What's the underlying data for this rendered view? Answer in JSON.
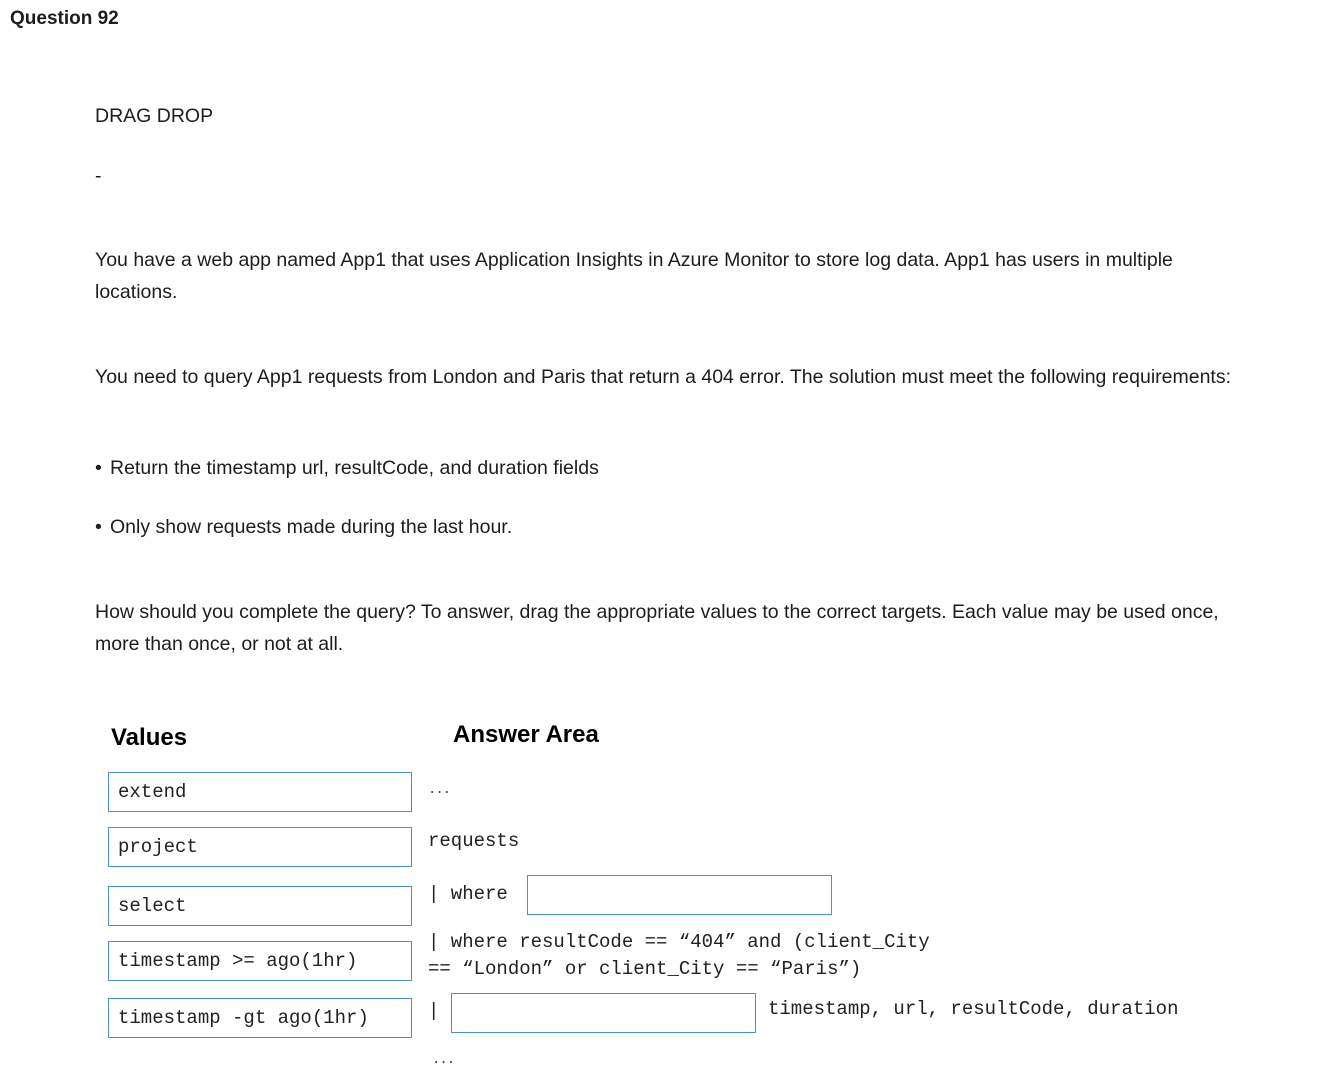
{
  "question": {
    "title": "Question 92"
  },
  "body": {
    "type_label": "DRAG DROP",
    "separator": "-",
    "paragraph1": "You have a web app named App1 that uses Application Insights in Azure Monitor to store log data. App1 has users in multiple locations.",
    "paragraph2": "You need to query App1 requests from London and Paris that return a 404 error. The solution must meet the following requirements:",
    "bullets": [
      {
        "marker": "•",
        "text": "Return the timestamp url, resultCode, and duration fields"
      },
      {
        "marker": "•",
        "text": "Only show requests made during the last hour."
      }
    ],
    "paragraph3": "How should you complete the query? To answer, drag the appropriate values to the correct targets. Each value may be used once, more than once, or not at all."
  },
  "values_panel": {
    "heading": "Values",
    "items": [
      "extend",
      "project",
      "select",
      "timestamp >= ago(1hr)",
      "timestamp -gt ago(1hr)"
    ]
  },
  "answer_area": {
    "heading": "Answer Area",
    "ellipsis_top": "...",
    "line_requests": "requests",
    "line_where_prefix": "| where",
    "line_filter_1": "| where resultCode == “404” and (client_City",
    "line_filter_2": "== “London” or client_City == “Paris”)",
    "line_pipe": "|",
    "line_fields": "timestamp, url, resultCode, duration",
    "ellipsis_bottom": "..."
  }
}
